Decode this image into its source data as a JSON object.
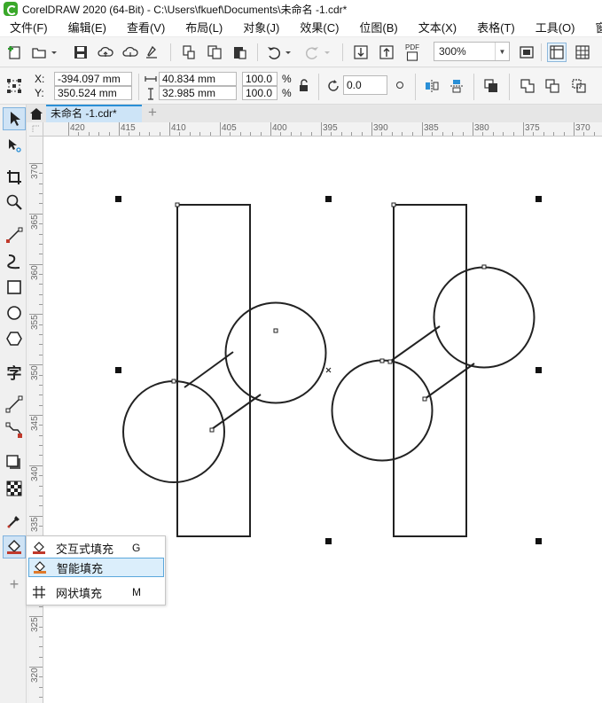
{
  "window": {
    "title": "CorelDRAW 2020 (64-Bit) - C:\\Users\\fkuef\\Documents\\未命名 -1.cdr*"
  },
  "menu": [
    {
      "label": "文件(F)"
    },
    {
      "label": "编辑(E)"
    },
    {
      "label": "查看(V)"
    },
    {
      "label": "布局(L)"
    },
    {
      "label": "对象(J)"
    },
    {
      "label": "效果(C)"
    },
    {
      "label": "位图(B)"
    },
    {
      "label": "文本(X)"
    },
    {
      "label": "表格(T)"
    },
    {
      "label": "工具(O)"
    },
    {
      "label": "窗口"
    }
  ],
  "toolbar": {
    "zoom": "300%",
    "pdf_label": "PDF"
  },
  "properties": {
    "x_label": "X:",
    "y_label": "Y:",
    "x_value": "-394.097 mm",
    "y_value": "350.524 mm",
    "width_value": "40.834 mm",
    "height_value": "32.985 mm",
    "scale_x": "100.0",
    "scale_y": "100.0",
    "percent_x": "%",
    "percent_y": "%",
    "rotation": "0.0"
  },
  "tabs": {
    "document": "未命名 -1.cdr*",
    "add": "+"
  },
  "rulers": {
    "horizontal": [
      "420",
      "415",
      "410",
      "405",
      "400",
      "395",
      "390",
      "385",
      "380",
      "375",
      "370"
    ],
    "vertical": [
      "370",
      "365",
      "360",
      "355",
      "350",
      "345",
      "340",
      "335",
      "330",
      "325",
      "320"
    ]
  },
  "flyout": {
    "items": [
      {
        "label": "交互式填充",
        "shortcut": "G",
        "icon": "interactive-fill-icon"
      },
      {
        "label": "智能填充",
        "shortcut": "",
        "icon": "smart-fill-icon"
      },
      {
        "label": "网状填充",
        "shortcut": "M",
        "icon": "mesh-fill-icon"
      }
    ]
  },
  "toolbox": {
    "add_tool": "+"
  },
  "colors": {
    "selection_tab": "#cde4f7",
    "highlight": "#dbeefb",
    "accent": "#2a8fd6"
  }
}
